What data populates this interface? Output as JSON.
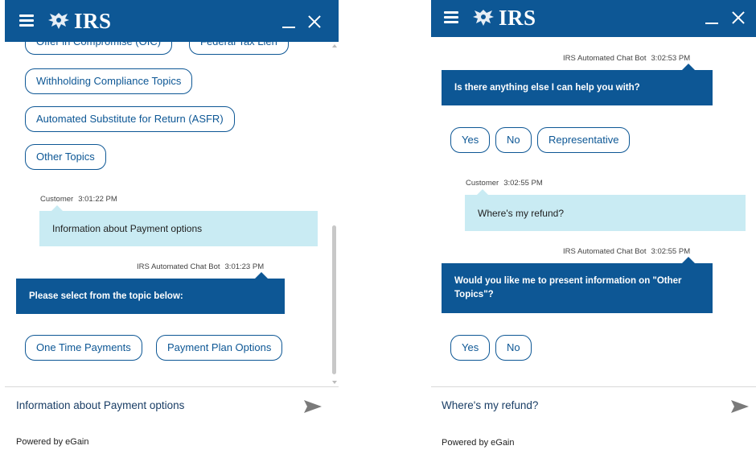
{
  "brand": {
    "logo_text": "IRS"
  },
  "left": {
    "topic_buttons_row1": [
      "Offer in Compromise (OIC)",
      "Federal Tax Lien"
    ],
    "topic_buttons": [
      "Withholding Compliance Topics",
      "Automated Substitute for Return (ASFR)",
      "Other Topics"
    ],
    "customer_msg": {
      "sender": "Customer",
      "time": "3:01:22 PM",
      "text": "Information about Payment options"
    },
    "bot_msg": {
      "sender": "IRS Automated Chat Bot",
      "time": "3:01:23 PM",
      "text": "Please select from the topic below:"
    },
    "option_buttons": [
      "One Time Payments",
      "Payment Plan Options"
    ],
    "input_value": "Information about Payment options",
    "powered_by": "Powered by eGain"
  },
  "right": {
    "bot_msg_1": {
      "sender": "IRS Automated Chat Bot",
      "time": "3:02:53 PM",
      "text": "Is there anything else I can help you with?"
    },
    "options_1": [
      "Yes",
      "No",
      "Representative"
    ],
    "customer_msg": {
      "sender": "Customer",
      "time": "3:02:55 PM",
      "text": "Where's my refund?"
    },
    "bot_msg_2": {
      "sender": "IRS Automated Chat Bot",
      "time": "3:02:55 PM",
      "text": "Would you like me to present information on \"Other Topics\"?"
    },
    "options_2": [
      "Yes",
      "No"
    ],
    "input_value": "Where's my refund?",
    "powered_by": "Powered by eGain"
  },
  "colors": {
    "header": "#0d5795",
    "customer_bubble": "#c9ebf3",
    "bot_bubble": "#0d5795"
  },
  "icons": [
    "menu-icon",
    "irs-eagle-icon",
    "minimize-icon",
    "close-icon",
    "send-icon"
  ]
}
